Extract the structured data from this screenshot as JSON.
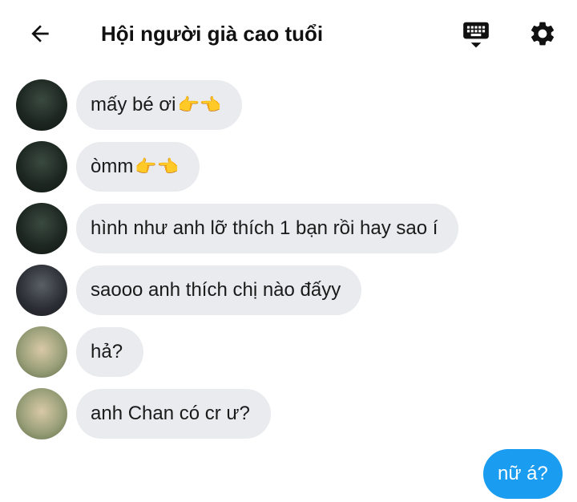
{
  "header": {
    "title": "Hội người già cao tuổi",
    "back_icon": "arrow-left-icon",
    "keyboard_icon": "keyboard-icon",
    "settings_icon": "gear-icon"
  },
  "messages": [
    {
      "sender": "incoming",
      "text": "mấy bé ơi",
      "emoji": "👉👈"
    },
    {
      "sender": "incoming",
      "text": "òmm",
      "emoji": "👉👈"
    },
    {
      "sender": "incoming",
      "text": "hình như anh lỡ thích 1 bạn rồi hay sao í",
      "emoji": ""
    },
    {
      "sender": "incoming",
      "text": "saooo anh thích chị nào đấyy",
      "emoji": ""
    },
    {
      "sender": "incoming",
      "text": "hả?",
      "emoji": ""
    },
    {
      "sender": "incoming",
      "text": "anh Chan có cr ư?",
      "emoji": ""
    },
    {
      "sender": "outgoing",
      "text": "nữ á?",
      "emoji": ""
    }
  ],
  "colors": {
    "incoming_bubble": "#e9ebee",
    "outgoing_bubble": "#1a9cf0",
    "outgoing_text": "#ffffff"
  }
}
